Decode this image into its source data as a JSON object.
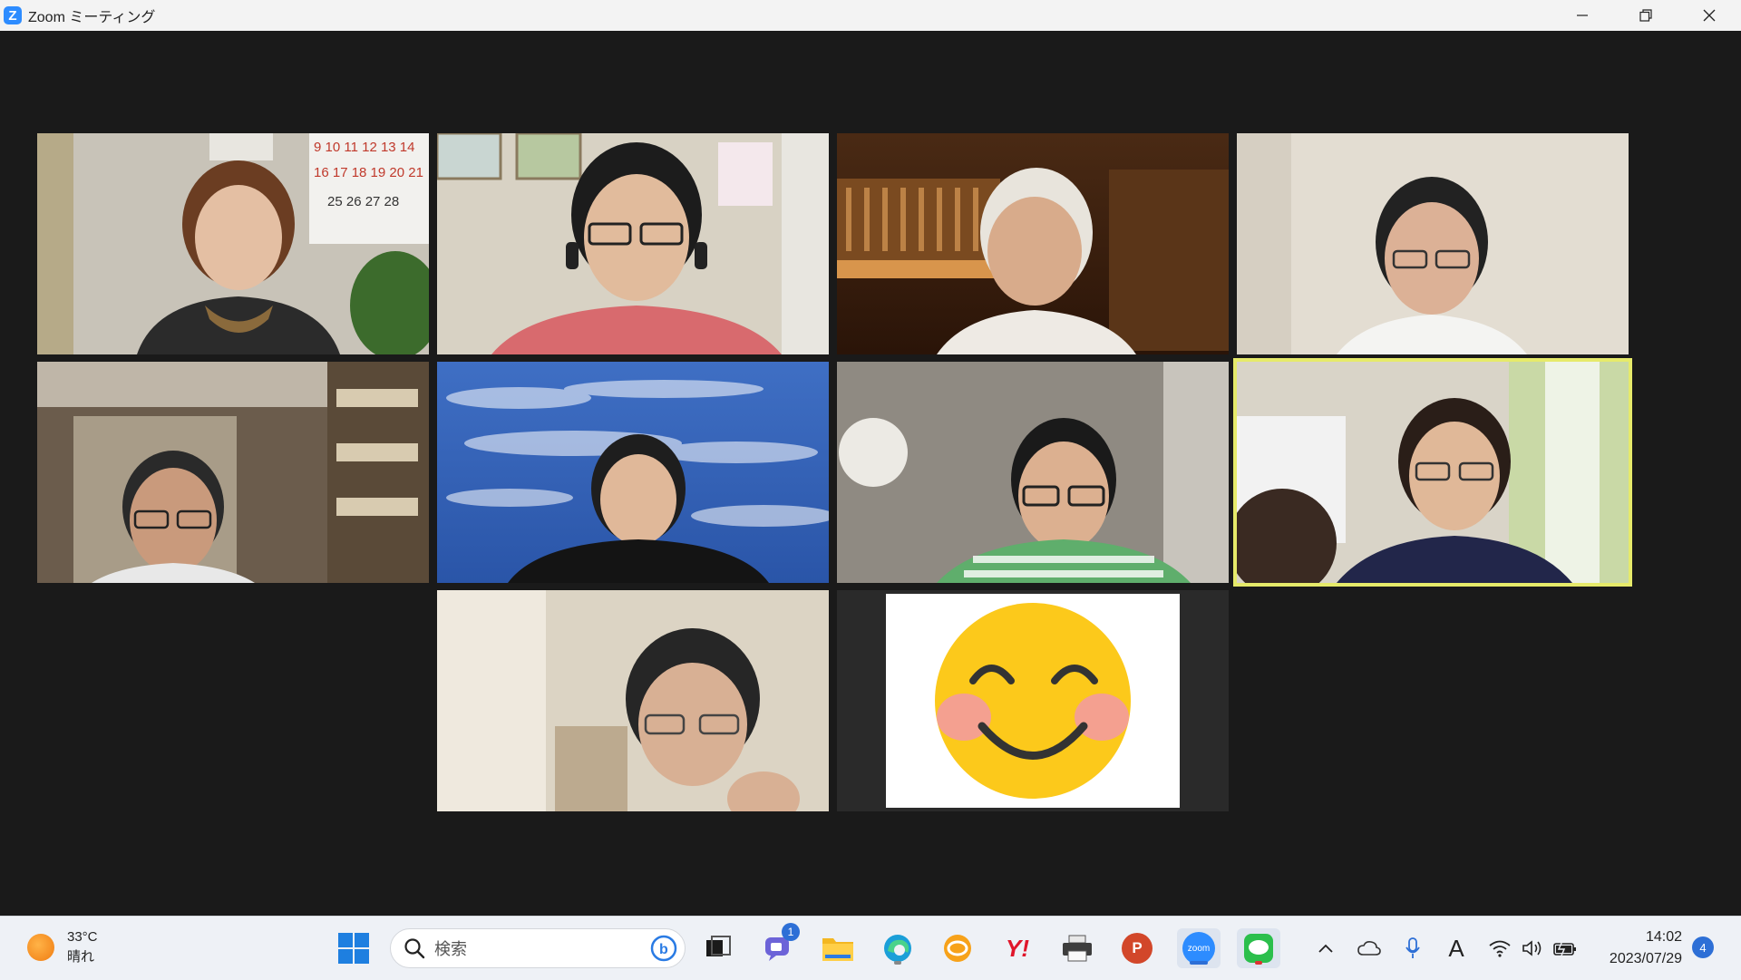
{
  "window": {
    "app_icon_letter": "Z",
    "title": "Zoom ミーティング"
  },
  "participants": [
    {
      "id": 1,
      "state": "video"
    },
    {
      "id": 2,
      "state": "video"
    },
    {
      "id": 3,
      "state": "video"
    },
    {
      "id": 4,
      "state": "video"
    },
    {
      "id": 5,
      "state": "video"
    },
    {
      "id": 6,
      "state": "video"
    },
    {
      "id": 7,
      "state": "video"
    },
    {
      "id": 8,
      "state": "video",
      "active_speaker": true
    },
    {
      "id": 9,
      "state": "video"
    },
    {
      "id": 10,
      "state": "avatar-smiley"
    }
  ],
  "calendar_text": {
    "row1": "9 10 11 12 13 14",
    "row2": "16 17 18 19 20 21",
    "row3": "25 26 27 28"
  },
  "taskbar": {
    "weather": {
      "temp": "33°C",
      "condition": "晴れ"
    },
    "search_placeholder": "検索",
    "teams_badge": "1",
    "zoom_label": "zoom",
    "yahoo_label": "Y!",
    "powerpoint_label": "P",
    "clock": {
      "time": "14:02",
      "date": "2023/07/29"
    },
    "notification_count": "4",
    "ime_label": "A"
  },
  "colors": {
    "active_speaker_border": "#e6ea6a",
    "accent_blue": "#2d8cff",
    "taskbar_bg": "#eef1f6"
  }
}
